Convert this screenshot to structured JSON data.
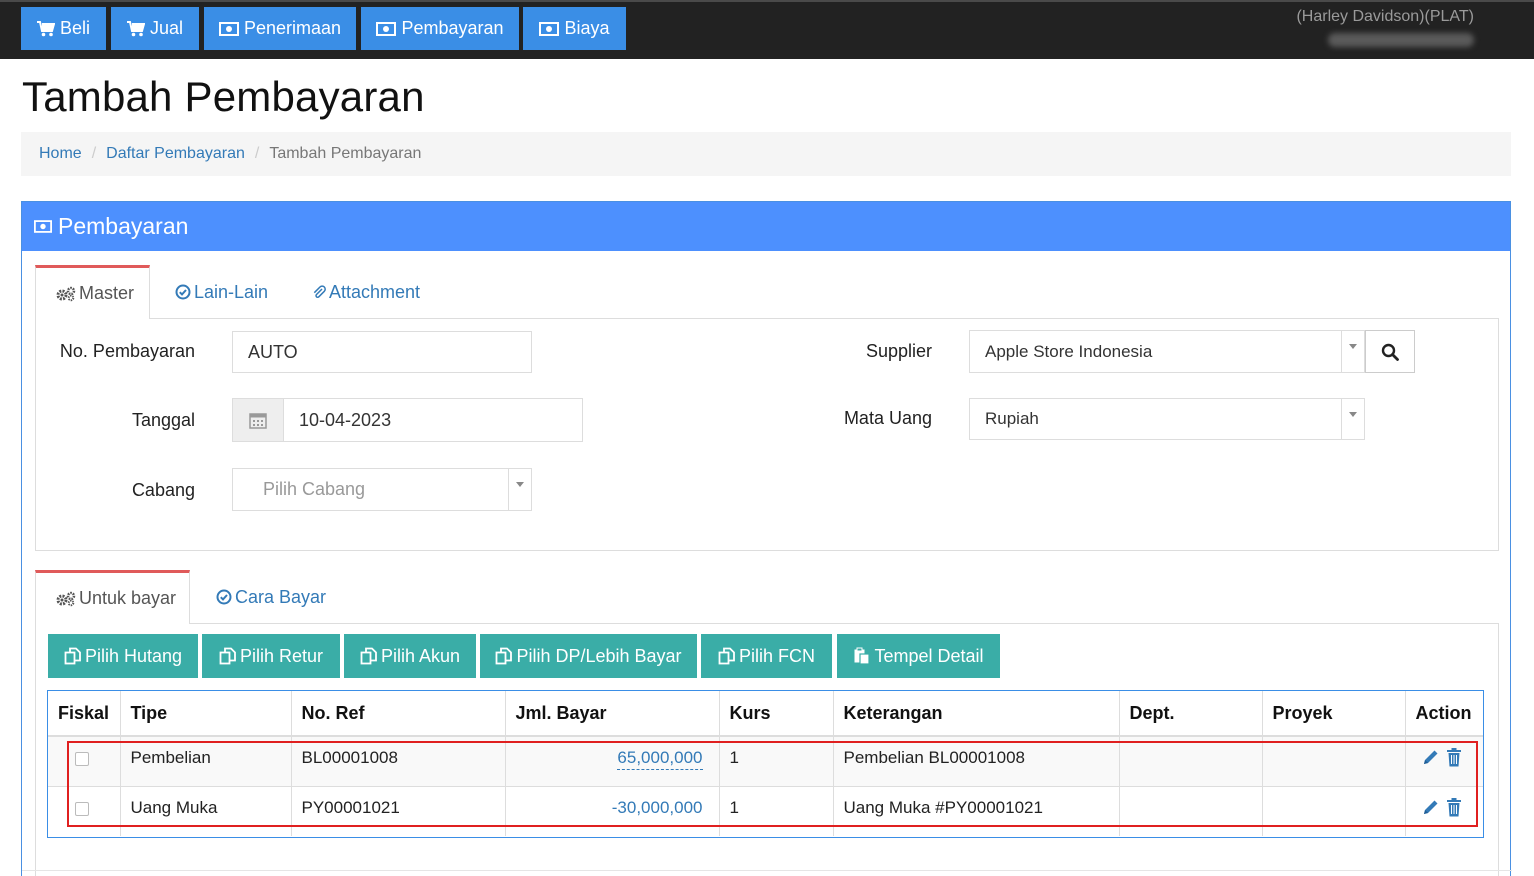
{
  "navbar": {
    "buttons": [
      {
        "label": "Beli",
        "icon": "cart-icon"
      },
      {
        "label": "Jual",
        "icon": "cart-icon"
      },
      {
        "label": "Penerimaan",
        "icon": "money-icon"
      },
      {
        "label": "Pembayaran",
        "icon": "money-icon"
      },
      {
        "label": "Biaya",
        "icon": "money-icon"
      }
    ],
    "company": "(Harley Davidson)(PLAT)"
  },
  "page": {
    "title": "Tambah Pembayaran"
  },
  "breadcrumb": {
    "home": "Home",
    "list": "Daftar Pembayaran",
    "current": "Tambah Pembayaran"
  },
  "panel": {
    "title": "Pembayaran"
  },
  "master_tabs": {
    "master": "Master",
    "lain": "Lain-Lain",
    "attachment": "Attachment"
  },
  "form": {
    "no_label": "No. Pembayaran",
    "no_value": "AUTO",
    "tanggal_label": "Tanggal",
    "tanggal_value": "10-04-2023",
    "cabang_label": "Cabang",
    "cabang_placeholder": "Pilih Cabang",
    "supplier_label": "Supplier",
    "supplier_value": "Apple Store Indonesia",
    "mata_uang_label": "Mata Uang",
    "mata_uang_value": "Rupiah"
  },
  "detail_tabs": {
    "untuk_bayar": "Untuk bayar",
    "cara_bayar": "Cara Bayar"
  },
  "actions": {
    "pilih_hutang": "Pilih Hutang",
    "pilih_retur": "Pilih Retur",
    "pilih_akun": "Pilih Akun",
    "pilih_dp": "Pilih DP/Lebih Bayar",
    "pilih_fcn": "Pilih FCN",
    "tempel_detail": "Tempel Detail"
  },
  "table": {
    "headers": [
      "Fiskal",
      "Tipe",
      "No. Ref",
      "Jml. Bayar",
      "Kurs",
      "Keterangan",
      "Dept.",
      "Proyek",
      "Action"
    ],
    "rows": [
      {
        "tipe": "Pembelian",
        "no_ref": "BL00001008",
        "jml_bayar": "65,000,000",
        "kurs": "1",
        "keterangan": "Pembelian BL00001008",
        "dept": "",
        "proyek": ""
      },
      {
        "tipe": "Uang Muka",
        "no_ref": "PY00001021",
        "jml_bayar": "-30,000,000",
        "kurs": "1",
        "keterangan": "Uang Muka #PY00001021",
        "dept": "",
        "proyek": ""
      }
    ]
  },
  "colors": {
    "navbar": "#222222",
    "nav_button": "#3a8ee6",
    "panel_head": "#4d90fe",
    "action_button": "#3aada7",
    "highlight": "#e02020"
  }
}
